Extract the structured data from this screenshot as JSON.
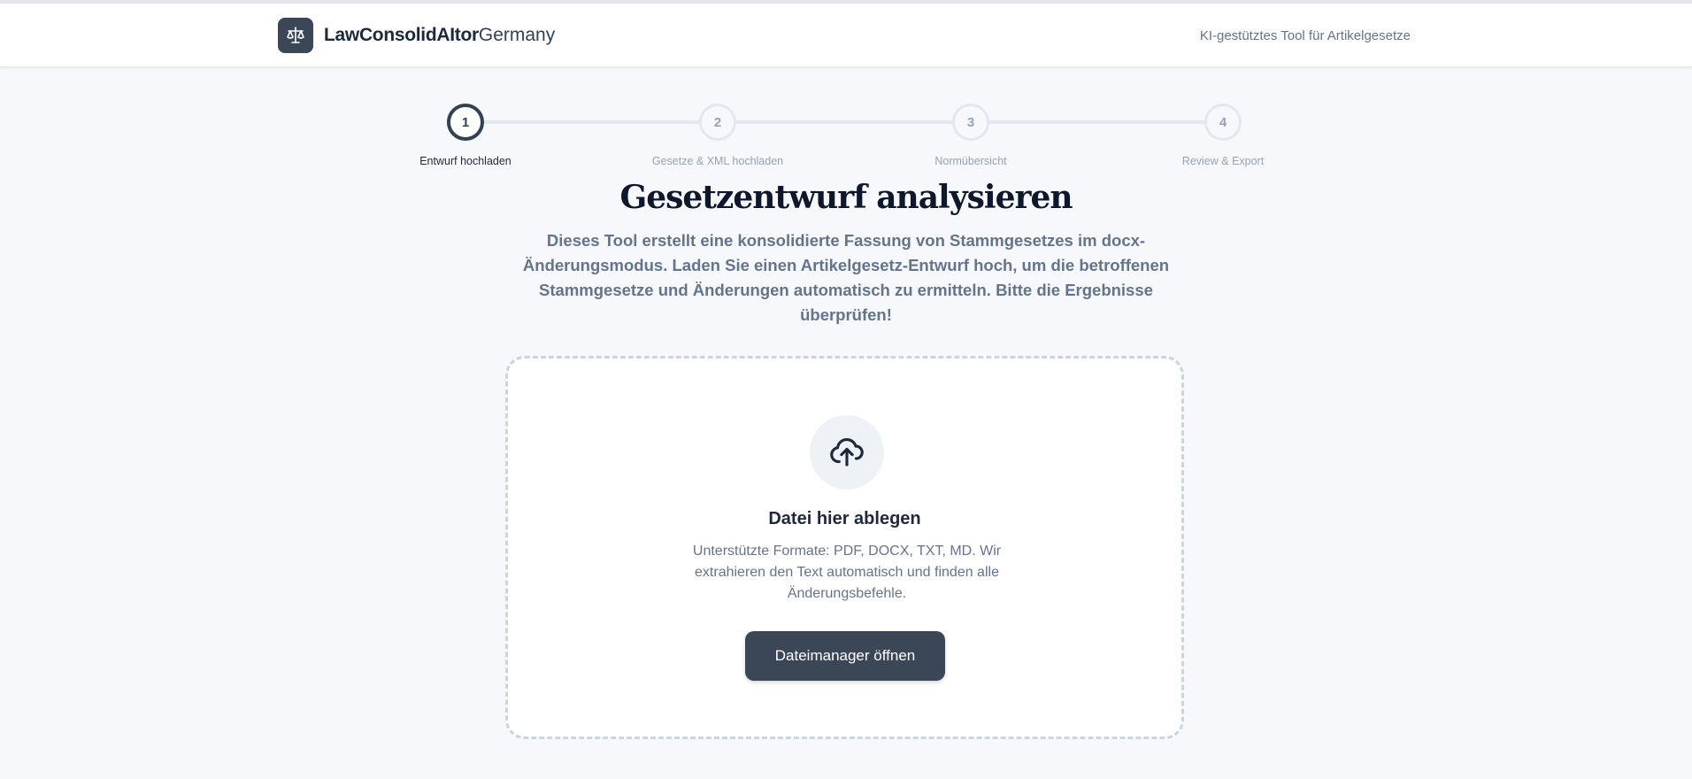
{
  "header": {
    "brand_bold": "LawConsolidAItor",
    "brand_light": "Germany",
    "tagline": "KI-gestütztes Tool für Artikelgesetze"
  },
  "stepper": {
    "steps": [
      {
        "number": "1",
        "label": "Entwurf hochladen",
        "active": true
      },
      {
        "number": "2",
        "label": "Gesetze & XML hochladen",
        "active": false
      },
      {
        "number": "3",
        "label": "Normübersicht",
        "active": false
      },
      {
        "number": "4",
        "label": "Review & Export",
        "active": false
      }
    ]
  },
  "main": {
    "title": "Gesetzentwurf analysieren",
    "intro": "Dieses Tool erstellt eine konsolidierte Fassung von Stammgesetzes im docx-Änderungsmodus. Laden Sie einen Artikelgesetz-Entwurf hoch, um die betroffenen Stammgesetze und Änderungen automatisch zu ermitteln. Bitte die Ergebnisse überprüfen!"
  },
  "dropzone": {
    "icon": "cloud-upload-icon",
    "title": "Datei hier ablegen",
    "description": "Unterstützte Formate: PDF, DOCX, TXT, MD. Wir extrahieren den Text automatisch und finden alle Änderungsbefehle.",
    "button_label": "Dateimanager öffnen"
  },
  "colors": {
    "accent": "#3b4657",
    "background": "#f6f8fb",
    "muted_text": "#64748b",
    "inactive_step": "#94a3b8"
  }
}
